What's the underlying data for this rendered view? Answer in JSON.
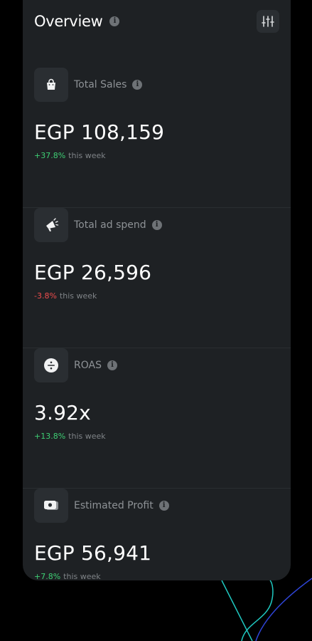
{
  "overview": {
    "title": "Overview"
  },
  "metrics": [
    {
      "icon": "shopping-bag-icon",
      "label": "Total Sales",
      "value": "EGP 108,159",
      "change": "+37.8%",
      "period": "this week",
      "trend": "up"
    },
    {
      "icon": "megaphone-icon",
      "label": "Total ad spend",
      "value": "EGP 26,596",
      "change": "-3.8%",
      "period": "this week",
      "trend": "down"
    },
    {
      "icon": "divide-icon",
      "label": "ROAS",
      "value": "3.92x",
      "change": "+13.8%",
      "period": "this week",
      "trend": "up"
    },
    {
      "icon": "cash-icon",
      "label": "Estimated Profit",
      "value": "EGP 56,941",
      "change": "+7.8%",
      "period": "this week",
      "trend": "up"
    }
  ],
  "colors": {
    "background": "#000000",
    "card": "#1e2124",
    "positive": "#3ecf74",
    "negative": "#ef4d4d",
    "muted_text": "#8e9296"
  }
}
